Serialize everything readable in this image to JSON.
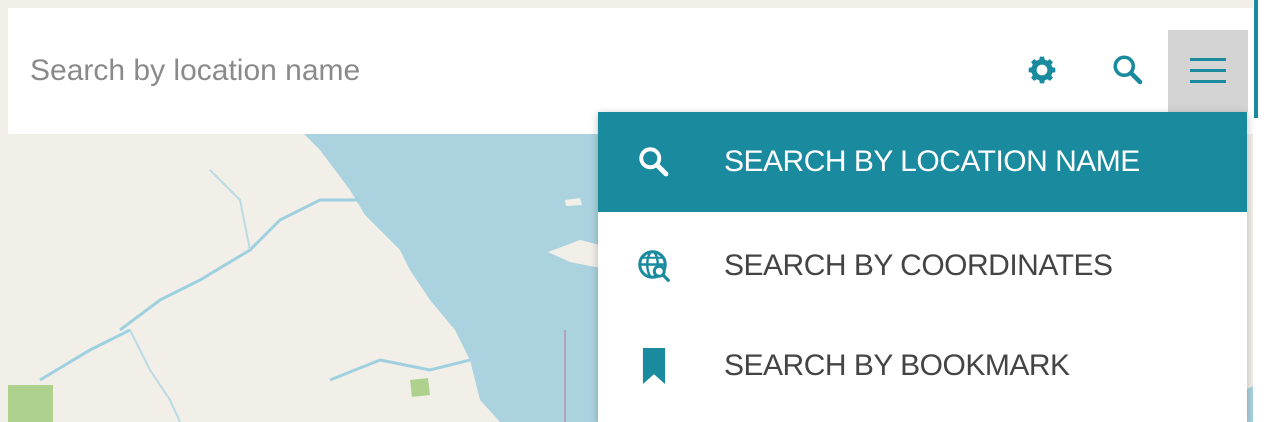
{
  "search": {
    "placeholder": "Search by location name",
    "value": ""
  },
  "toolbar": {
    "settings_icon": "gear-icon",
    "search_icon": "search-icon",
    "menu_icon": "hamburger-menu-icon"
  },
  "menu": {
    "items": [
      {
        "label": "SEARCH BY LOCATION NAME",
        "icon": "search-icon",
        "active": true
      },
      {
        "label": "SEARCH BY COORDINATES",
        "icon": "globe-search-icon",
        "active": false
      },
      {
        "label": "SEARCH BY BOOKMARK",
        "icon": "bookmark-icon",
        "active": false
      }
    ]
  },
  "colors": {
    "accent": "#1a8a9e",
    "water": "#aad3df",
    "land": "#f2efe9",
    "park": "#aed18d",
    "river": "#9fd0e0"
  }
}
